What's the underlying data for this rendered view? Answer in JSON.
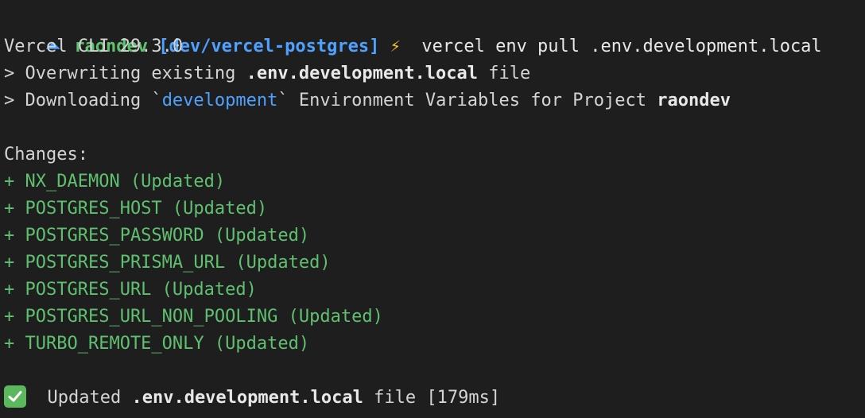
{
  "prompt": {
    "arrow": "⏶",
    "user": "raondev",
    "branch": "[dev/vercel-postgres]",
    "bolt": "⚡",
    "command": "vercel env pull .env.development.local"
  },
  "output": {
    "cli_version": "Vercel CLI 29.3.0",
    "overwrite_prefix": "> Overwriting existing ",
    "overwrite_file": ".env.development.local",
    "overwrite_suffix": " file",
    "download_prefix": "> Downloading `",
    "download_env": "development",
    "download_middle": "` Environment Variables for Project ",
    "download_project": "raondev",
    "changes_heading": "Changes:",
    "changes": [
      "+ NX_DAEMON (Updated)",
      "+ POSTGRES_HOST (Updated)",
      "+ POSTGRES_PASSWORD (Updated)",
      "+ POSTGRES_PRISMA_URL (Updated)",
      "+ POSTGRES_URL (Updated)",
      "+ POSTGRES_URL_NON_POOLING (Updated)",
      "+ TURBO_REMOTE_ONLY (Updated)"
    ],
    "result_prefix": "Updated ",
    "result_file": ".env.development.local",
    "result_suffix": " file [179ms]"
  },
  "colors": {
    "background": "#1e1e1e",
    "text": "#d4d4d4",
    "green": "#5fc06f",
    "blue": "#4ea1ff",
    "yellow": "#f3c12a"
  },
  "icons": {
    "prompt_arrow": "prompt-arrow-icon",
    "bolt": "lightning-bolt-icon",
    "success": "check-mark-icon"
  }
}
